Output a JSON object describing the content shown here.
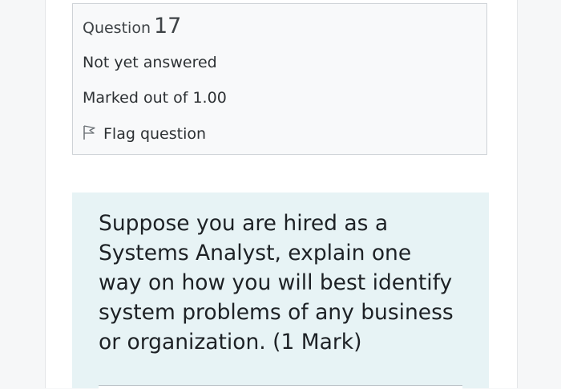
{
  "question_info": {
    "label": "Question",
    "number": "17",
    "state": "Not yet answered",
    "grade": "Marked out of 1.00",
    "flag_label": "Flag question",
    "flag_icon": "flag-icon"
  },
  "question_text": "Suppose you are hired as a Systems Analyst, explain one way on how you will best identify system problems of any business or organization. (1 Mark)"
}
